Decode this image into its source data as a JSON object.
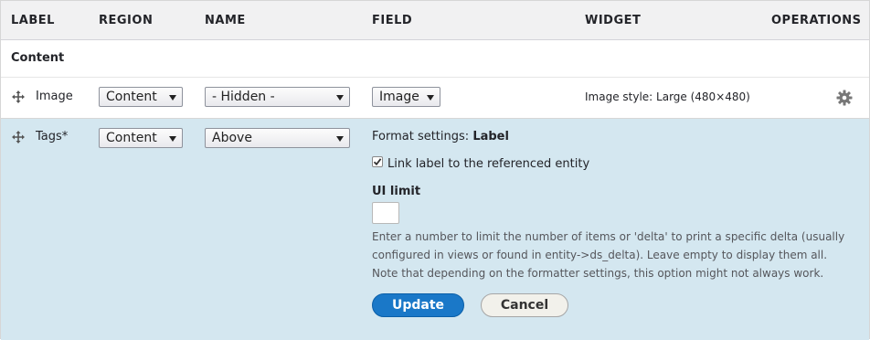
{
  "header": {
    "label": "LABEL",
    "region": "REGION",
    "name": "NAME",
    "field": "FIELD",
    "widget": "WIDGET",
    "operations": "OPERATIONS"
  },
  "region_title": "Content",
  "rows": [
    {
      "label": "Image",
      "region": "Content",
      "name": "- Hidden -",
      "field": "Image",
      "widget_summary": "Image style: Large (480×480)"
    },
    {
      "label": "Tags*",
      "region": "Content",
      "name": "Above",
      "format_settings_prefix": "Format settings:",
      "format_settings_name": "Label",
      "link_label_checkbox": "Link label to the referenced entity",
      "link_label_checked": true,
      "ui_limit_label": "UI limit",
      "ui_limit_value": "",
      "ui_limit_description_line1": "Enter a number to limit the number of items or 'delta' to print a specific delta (usually",
      "ui_limit_description_line2": "configured in views or found in entity->ds_delta). Leave empty to display them all.",
      "ui_limit_description_line3": "Note that depending on the formatter settings, this option might not always work.",
      "update_button": "Update",
      "cancel_button": "Cancel"
    }
  ],
  "icons": {
    "drag": "move-arrows-icon",
    "settings": "gear-icon",
    "select_arrow": "caret-down-icon"
  },
  "colors": {
    "header_bg": "#f1f1f2",
    "active_row_bg": "#d4e7f0",
    "primary_button": "#1a78c8"
  }
}
